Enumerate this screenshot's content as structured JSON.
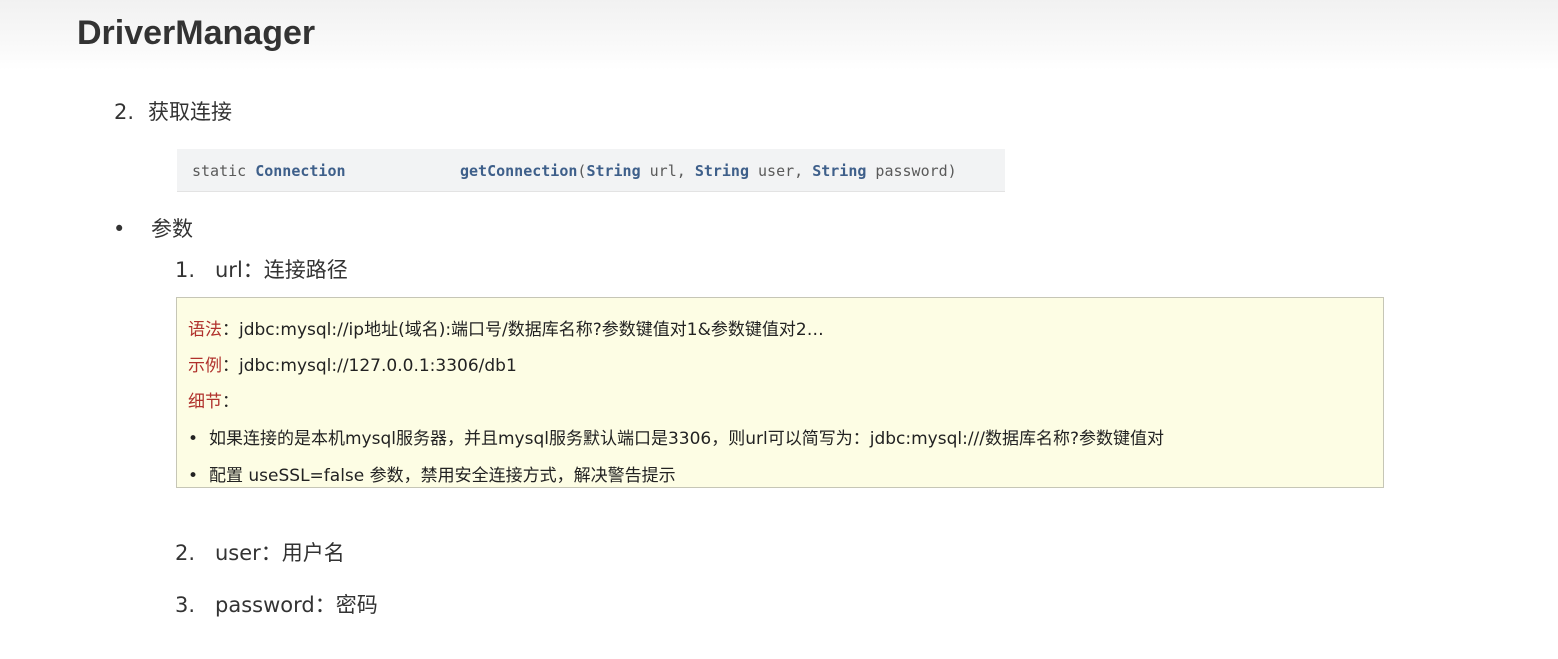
{
  "page": {
    "title": "DriverManager"
  },
  "step2": {
    "number": "2.",
    "label": "获取连接"
  },
  "method": {
    "modifier": "static",
    "return_type": "Connection",
    "name": "getConnection",
    "open": "(",
    "p1_type": "String",
    "p1_name": " url, ",
    "p2_type": "String",
    "p2_name": " user, ",
    "p3_type": "String",
    "p3_name": " password)"
  },
  "params": {
    "bullet": "•",
    "label": "参数",
    "items": [
      {
        "number": "1.",
        "label": "url：连接路径"
      },
      {
        "number": "2.",
        "label": "user：用户名"
      },
      {
        "number": "3.",
        "label": "password：密码"
      }
    ]
  },
  "note": {
    "syntax_label": "语法",
    "syntax_text": "：jdbc:mysql://ip地址(域名):端口号/数据库名称?参数键值对1&参数键值对2…",
    "example_label": "示例",
    "example_text": "：jdbc:mysql://127.0.0.1:3306/db1",
    "details_label": "细节",
    "details_colon": "：",
    "bullet": "•",
    "detail_1": "如果连接的是本机mysql服务器，并且mysql服务默认端口是3306，则url可以简写为：jdbc:mysql:///数据库名称?参数键值对",
    "detail_2": "配置 useSSL=false 参数，禁用安全连接方式，解决警告提示"
  },
  "colors": {
    "accent_red": "#b0312c",
    "keyword_blue": "#3e5f8a",
    "note_background": "#fdfde4"
  }
}
